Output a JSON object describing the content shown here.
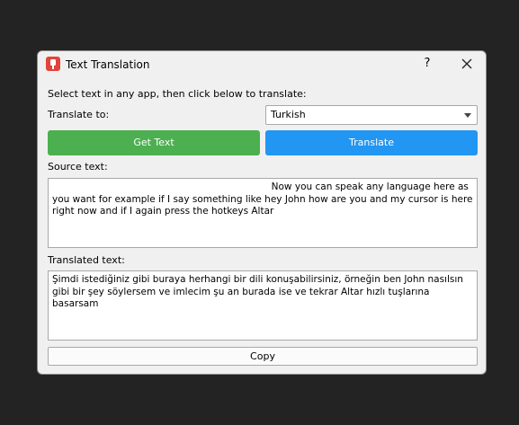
{
  "window": {
    "title": "Text Translation",
    "app_icon": "app-logo-icon",
    "help_label": "?",
    "close_icon": "close-icon"
  },
  "instruction": "Select text in any app, then click below to translate:",
  "translate_to": {
    "label": "Translate to:",
    "selected": "Turkish"
  },
  "buttons": {
    "get_text": "Get Text",
    "translate": "Translate",
    "copy": "Copy"
  },
  "source": {
    "label": "Source text:",
    "text": "                                                                         Now you can speak any language here as you want for example if I say something like hey John how are you and my cursor is here right now and if I again press the hotkeys Altar"
  },
  "translated": {
    "label": "Translated text:",
    "text": "Şimdi istediğiniz gibi buraya herhangi bir dili konuşabilirsiniz, örneğin ben John nasılsın gibi bir şey söylersem ve imlecim şu an burada ise ve tekrar Altar hızlı tuşlarına basarsam"
  },
  "colors": {
    "get_text_button": "#4caf50",
    "translate_button": "#2196f3",
    "app_icon": "#e0443c",
    "background": "#232323"
  }
}
